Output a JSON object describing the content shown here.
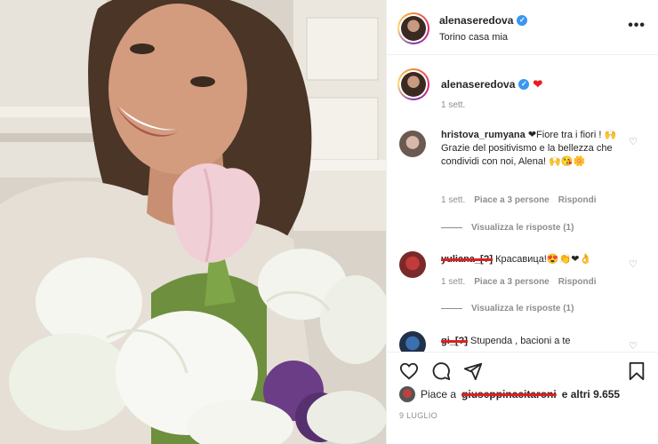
{
  "post": {
    "username": "alenaseredova",
    "location": "Torino casa mia",
    "more_label": "•••"
  },
  "caption": {
    "username": "alenaseredova",
    "text": "❤",
    "time": "1 sett."
  },
  "comments": [
    {
      "username": "hristova_rumyana",
      "text": "❤Fiore tra i fiori ! 🙌Grazie del positivismo e la bellezza che condividi con noi, Alena! 🙌😘🌼",
      "time": "1 sett.",
      "likes": "Piace a 3 persone",
      "reply": "Rispondi",
      "view_replies": "Visualizza le risposte (1)"
    },
    {
      "username": "yuliana_[?]",
      "text": "Красавица!😍👏❤👌",
      "time": "1 sett.",
      "likes": "Piace a 3 persone",
      "reply": "Rispondi",
      "view_replies": "Visualizza le risposte (1)"
    },
    {
      "username": "gi_[?]",
      "text": "Stupenda , bacioni a te"
    }
  ],
  "likes": {
    "prefix": "Piace a",
    "user": "giuseppinacitaroni",
    "suffix": "e altri 9.655"
  },
  "date": "9 LUGLIO",
  "icons": {
    "like": "heart-icon",
    "comment": "comment-icon",
    "share": "share-icon",
    "save": "bookmark-icon",
    "verified": "verified-badge-icon",
    "comment_like": "small-heart-icon"
  },
  "colors": {
    "text": "#262626",
    "secondary": "#8e8e8e",
    "verified": "#3897f0",
    "heart": "#ed1c24",
    "border": "#efefef"
  }
}
